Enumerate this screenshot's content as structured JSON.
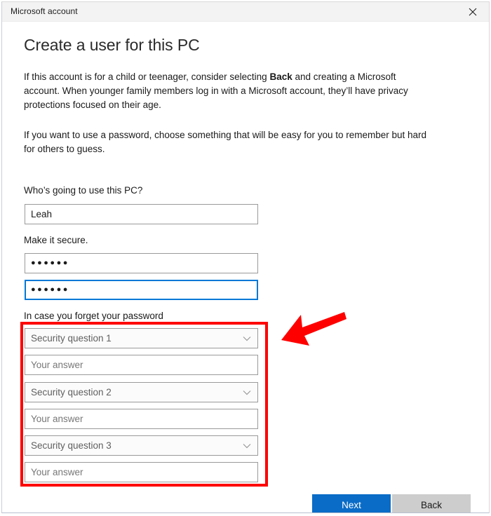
{
  "window": {
    "titlebar_text": "Microsoft account",
    "close_label": "Close"
  },
  "page": {
    "title": "Create a user for this PC",
    "paragraph_1_part1": "If this account is for a child or teenager, consider selecting ",
    "paragraph_1_bold": "Back",
    "paragraph_1_part2": " and creating a Microsoft account. When younger family members log in with a Microsoft account, they’ll have privacy protections focused on their age.",
    "paragraph_2": "If you want to use a password, choose something that will be easy for you to remember but hard for others to guess."
  },
  "form": {
    "username_label": "Who’s going to use this PC?",
    "username_value": "Leah",
    "password_label": "Make it secure.",
    "password_value": "●●●●●●",
    "password_confirm_value": "●●●●●●",
    "security_label": "In case you forget your password",
    "security": [
      {
        "question": "Security question 1",
        "answer_placeholder": "Your answer",
        "answer_value": ""
      },
      {
        "question": "Security question 2",
        "answer_placeholder": "Your answer",
        "answer_value": ""
      },
      {
        "question": "Security question 3",
        "answer_placeholder": "Your answer",
        "answer_value": ""
      }
    ]
  },
  "footer": {
    "next_label": "Next",
    "back_label": "Back"
  },
  "annotations": {
    "highlight_color": "#fe0000",
    "arrow_name": "red-arrow-pointing-to-security-questions"
  },
  "colors": {
    "accent_blue": "#0a6cc7",
    "focus_blue": "#0078d7",
    "titlebar_bg": "#f3f3f3",
    "button_secondary_bg": "#cdcdcd"
  }
}
